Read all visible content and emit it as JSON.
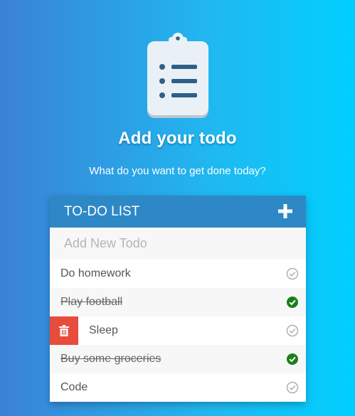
{
  "hero": {
    "icon": "clipboard-list-icon",
    "title": "Add your todo",
    "subtitle": "What do you want to get done today?"
  },
  "card": {
    "title": "TO-DO LIST",
    "add_icon": "plus-icon",
    "input_placeholder": "Add New Todo",
    "header_color": "#2e88c6"
  },
  "todos": [
    {
      "text": "Do homework",
      "done": false
    },
    {
      "text": "Play football",
      "done": true
    },
    {
      "text": "Sleep",
      "done": false,
      "delete_revealed": true
    },
    {
      "text": "Buy some groceries",
      "done": true
    },
    {
      "text": "Code",
      "done": false
    }
  ],
  "colors": {
    "done_check": "#1a7f1a",
    "pending_check": "#b0b0b0",
    "delete": "#e74c3c"
  }
}
